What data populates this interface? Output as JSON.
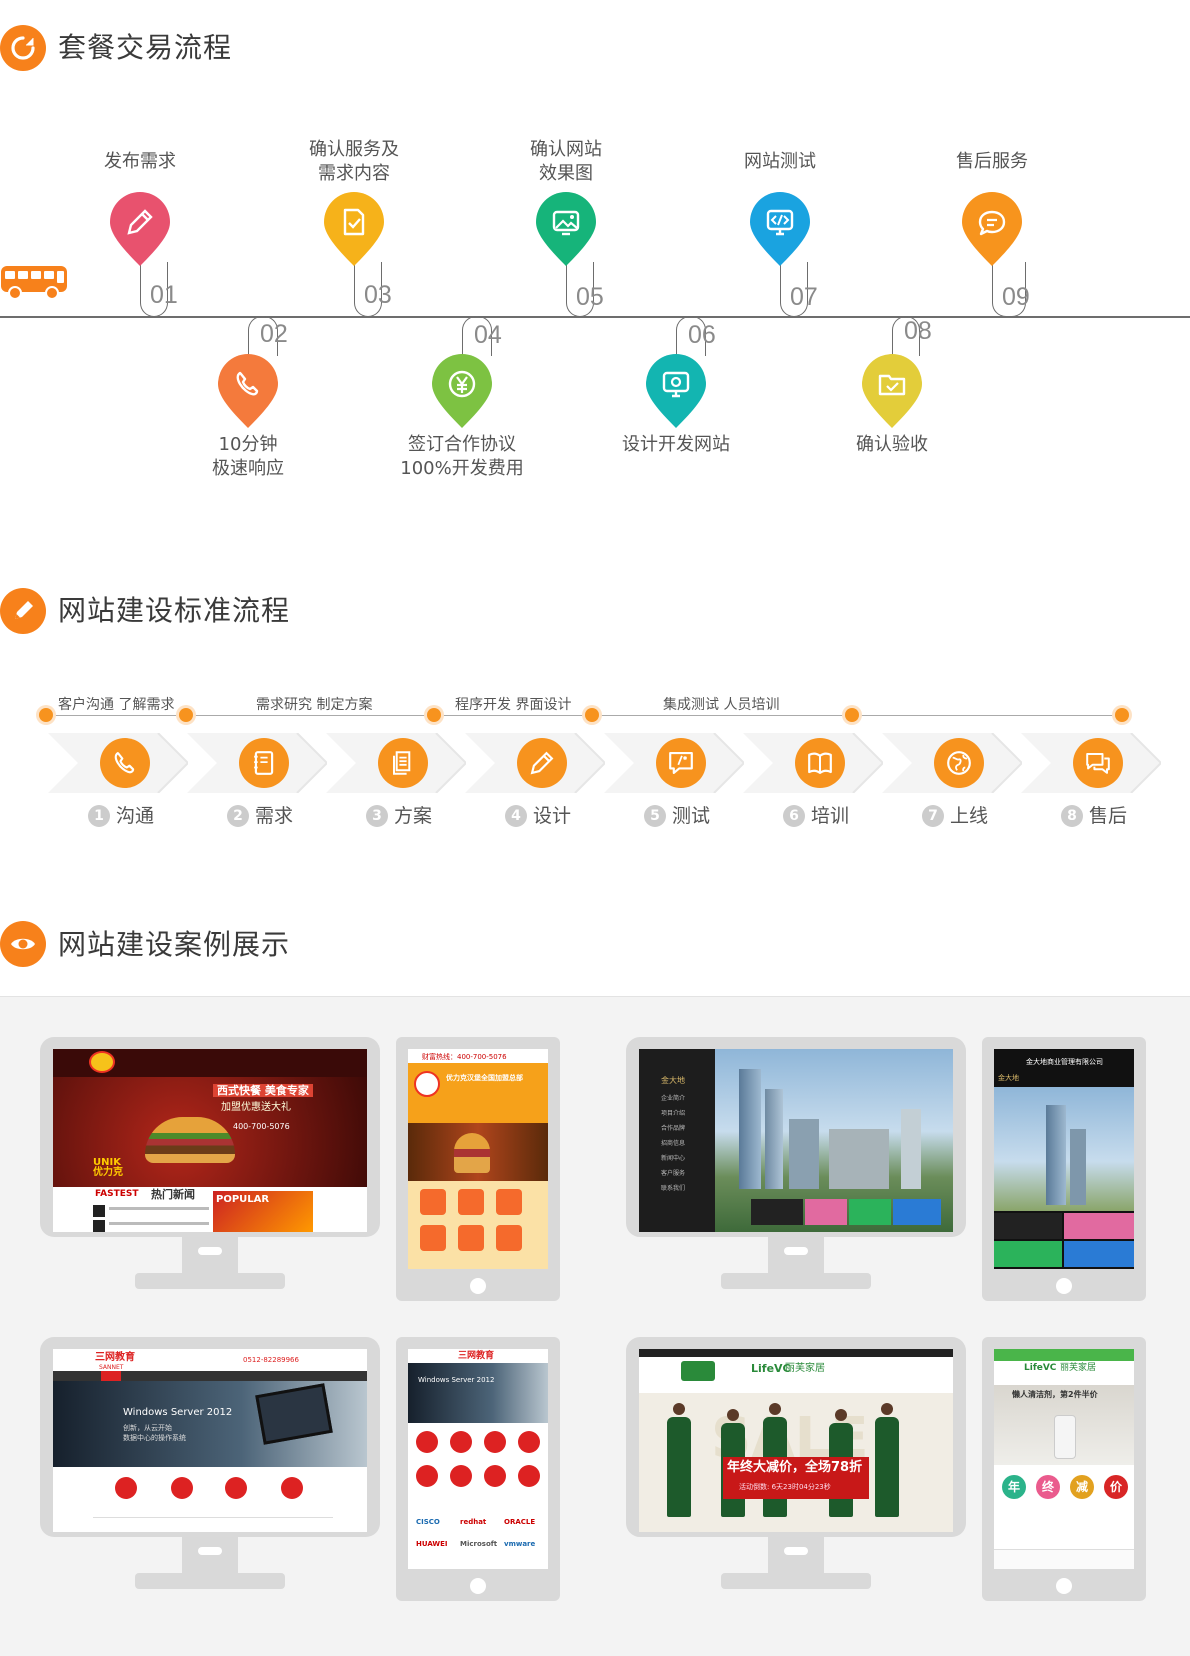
{
  "sections": {
    "trade": {
      "title": "套餐交易流程"
    },
    "build": {
      "title": "网站建设标准流程"
    },
    "cases": {
      "title": "网站建设案例展示"
    }
  },
  "trade_steps": [
    {
      "num": "01",
      "label": "发布需求",
      "color": "#e8526e",
      "icon": "pencil-icon"
    },
    {
      "num": "02",
      "label": "10分钟\n极速响应",
      "color": "#f47a3c",
      "icon": "phone-icon"
    },
    {
      "num": "03",
      "label": "确认服务及\n需求内容",
      "color": "#f6b21a",
      "icon": "document-check-icon"
    },
    {
      "num": "04",
      "label": "签订合作协议\n100%开发费用",
      "color": "#7dc242",
      "icon": "yen-icon"
    },
    {
      "num": "05",
      "label": "确认网站\n效果图",
      "color": "#16b47a",
      "icon": "image-icon"
    },
    {
      "num": "06",
      "label": "设计开发网站",
      "color": "#13b5b1",
      "icon": "monitor-gear-icon"
    },
    {
      "num": "07",
      "label": "网站测试",
      "color": "#1aa3e0",
      "icon": "code-icon"
    },
    {
      "num": "08",
      "label": "确认验收",
      "color": "#e3cd3a",
      "icon": "folder-check-icon"
    },
    {
      "num": "09",
      "label": "售后服务",
      "color": "#f7941d",
      "icon": "chat-icon"
    }
  ],
  "process_captions": [
    "客户沟通  了解需求",
    "需求研究  制定方案",
    "程序开发  界面设计",
    "集成测试  人员培训"
  ],
  "process_steps": [
    {
      "n": "1.",
      "label": "沟通",
      "icon": "phone-icon"
    },
    {
      "n": "2.",
      "label": "需求",
      "icon": "notebook-icon"
    },
    {
      "n": "3.",
      "label": "方案",
      "icon": "documents-icon"
    },
    {
      "n": "4.",
      "label": "设计",
      "icon": "pencil-icon"
    },
    {
      "n": "5.",
      "label": "测试",
      "icon": "comment-code-icon"
    },
    {
      "n": "6.",
      "label": "培训",
      "icon": "book-icon"
    },
    {
      "n": "7.",
      "label": "上线",
      "icon": "globe-icon"
    },
    {
      "n": "8.",
      "label": "售后",
      "icon": "chat-bubbles-icon"
    }
  ],
  "cases": {
    "unik": {
      "phone": "400-700-5076",
      "slogan1": "西式快餐 美食专家",
      "slogan2": "加盟优惠送大礼",
      "brand": "UNIK",
      "brand_cn": "优力克",
      "popular": "POPULAR",
      "fastest": "FASTEST",
      "news": "热门新闻",
      "m_phone": "财富热线：400-700-5076",
      "m_title": "优力克汉堡全国加盟总部"
    },
    "jinda": {
      "brand": "金大地",
      "menu": [
        "企业简介",
        "项目介绍",
        "合作品牌",
        "招商信息",
        "新闻中心",
        "客户服务",
        "联系我们"
      ],
      "m_title": "金大地商业管理有限公司"
    },
    "sanwang": {
      "logo": "三网教育",
      "logo_en": "SANNET",
      "phone": "0512-82289966",
      "hero_title": "Windows Server 2012",
      "hero_sub1": "创新，从云开始",
      "hero_sub2": "数据中心的操作系统",
      "partners": [
        "CISCO",
        "redhat",
        "ORACLE",
        "HUAWEI",
        "Microsoft",
        "vmware"
      ]
    },
    "lifevc": {
      "brand": "LifeVC",
      "brand_cn": "丽芙家居",
      "banner": "年终大减价，全场78折",
      "countdown": "活动倒数: 6天23时04分23秒",
      "sale": "SALE",
      "m_promo": "懒人清洁剂，第2件半价",
      "m_circles": [
        "年",
        "终",
        "减",
        "价"
      ]
    }
  }
}
